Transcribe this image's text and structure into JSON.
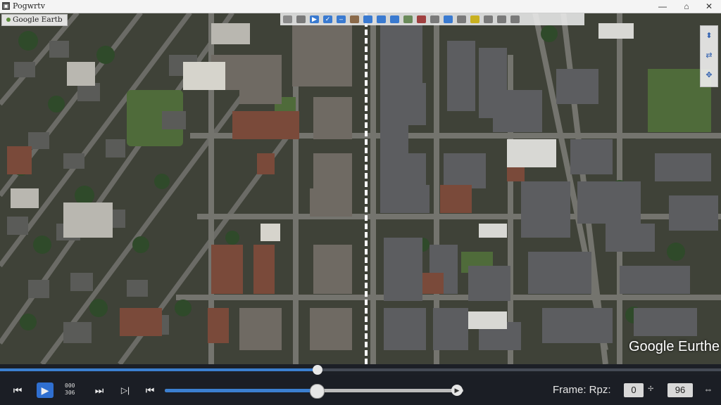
{
  "window": {
    "title": "Pogwrtv",
    "app_icon": "app-icon",
    "minimize": "—",
    "maximize": "⌂",
    "close": "✕"
  },
  "map": {
    "layer_label": "Google Eartb",
    "watermark": "Google Eurthe",
    "nav_icons": [
      "compass-icon",
      "tilt-icon",
      "zoom-icon"
    ],
    "toolbar_icons": [
      "layers-icon",
      "grid-icon",
      "play-icon",
      "check-icon",
      "minus-icon",
      "globe-icon",
      "placemark-icon",
      "path-icon",
      "polygon-icon",
      "image-overlay-icon",
      "tour-icon",
      "history-icon",
      "sun-icon",
      "planet-icon",
      "ruler-icon",
      "email-icon",
      "print-icon",
      "save-image-icon",
      "map-icon"
    ]
  },
  "controls": {
    "seek_progress": 0.44,
    "scrub_progress": 0.51,
    "prev_icon": "⏮",
    "play_icon": "▶",
    "timecode_top": "000",
    "timecode_bottom": "306",
    "step_back_icon": "⏭",
    "step_fwd_icon": "▷|",
    "skip_icon": "⏮",
    "frame_label": "Frame: Rpz:",
    "frame_value": "0",
    "frame_total": "96",
    "expand_icon": "⇔"
  },
  "colors": {
    "accent": "#3b7fd0",
    "control_bg": "#1b1e25"
  }
}
